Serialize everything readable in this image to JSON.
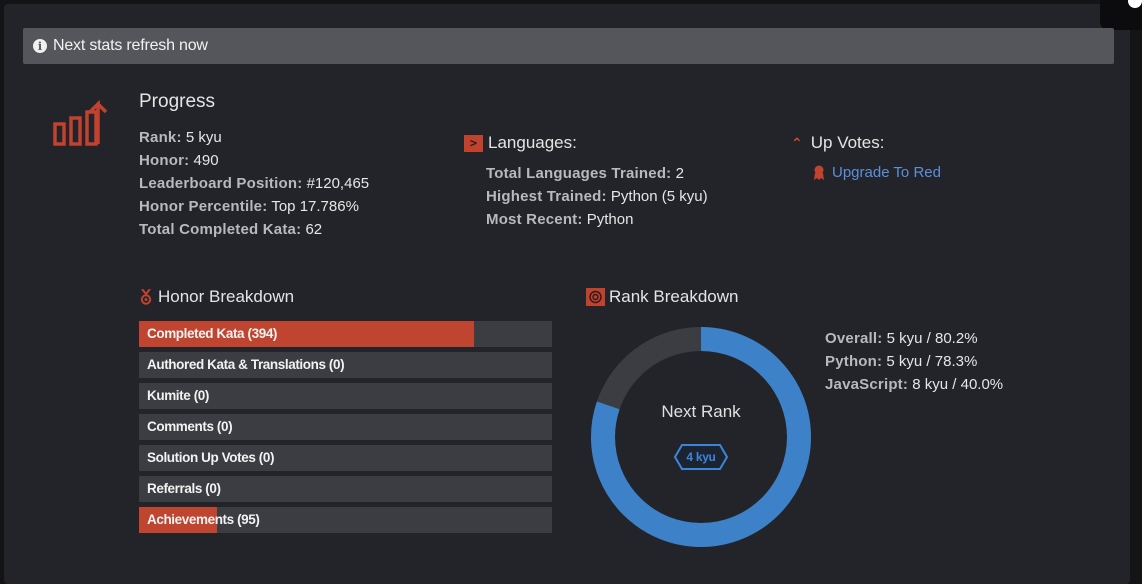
{
  "alert": {
    "text": "Next stats refresh now",
    "icon": "info-icon"
  },
  "progress": {
    "title": "Progress",
    "rows": [
      {
        "label": "Rank:",
        "value": "5 kyu"
      },
      {
        "label": "Honor:",
        "value": "490"
      },
      {
        "label": "Leaderboard Position:",
        "value": "#120,465"
      },
      {
        "label": "Honor Percentile:",
        "value": "Top 17.786%"
      },
      {
        "label": "Total Completed Kata:",
        "value": "62"
      }
    ]
  },
  "languages": {
    "title": "Languages:",
    "rows": [
      {
        "label": "Total Languages Trained:",
        "value": "2"
      },
      {
        "label": "Highest Trained:",
        "value": "Python (5 kyu)"
      },
      {
        "label": "Most Recent:",
        "value": "Python"
      }
    ]
  },
  "upvotes": {
    "title": "Up Votes:",
    "link": "Upgrade To Red"
  },
  "honor_breakdown": {
    "title": "Honor Breakdown",
    "bars": [
      {
        "label": "Completed Kata (394)",
        "fill": 0.81
      },
      {
        "label": "Authored Kata & Translations (0)",
        "fill": 0
      },
      {
        "label": "Kumite (0)",
        "fill": 0
      },
      {
        "label": "Comments (0)",
        "fill": 0
      },
      {
        "label": "Solution Up Votes (0)",
        "fill": 0
      },
      {
        "label": "Referrals (0)",
        "fill": 0
      },
      {
        "label": "Achievements (95)",
        "fill": 0.19
      }
    ]
  },
  "rank_breakdown": {
    "title": "Rank Breakdown",
    "next_rank_label": "Next Rank",
    "next_rank_badge": "4 kyu",
    "progress": 0.802,
    "rows": [
      {
        "label": "Overall:",
        "value": "5 kyu / 80.2%"
      },
      {
        "label": "Python:",
        "value": "5 kyu / 78.3%"
      },
      {
        "label": "JavaScript:",
        "value": "8 kyu / 40.0%"
      }
    ]
  },
  "colors": {
    "accent_red": "#bf4530",
    "accent_blue": "#3d82c8",
    "track": "#3c3d42"
  }
}
